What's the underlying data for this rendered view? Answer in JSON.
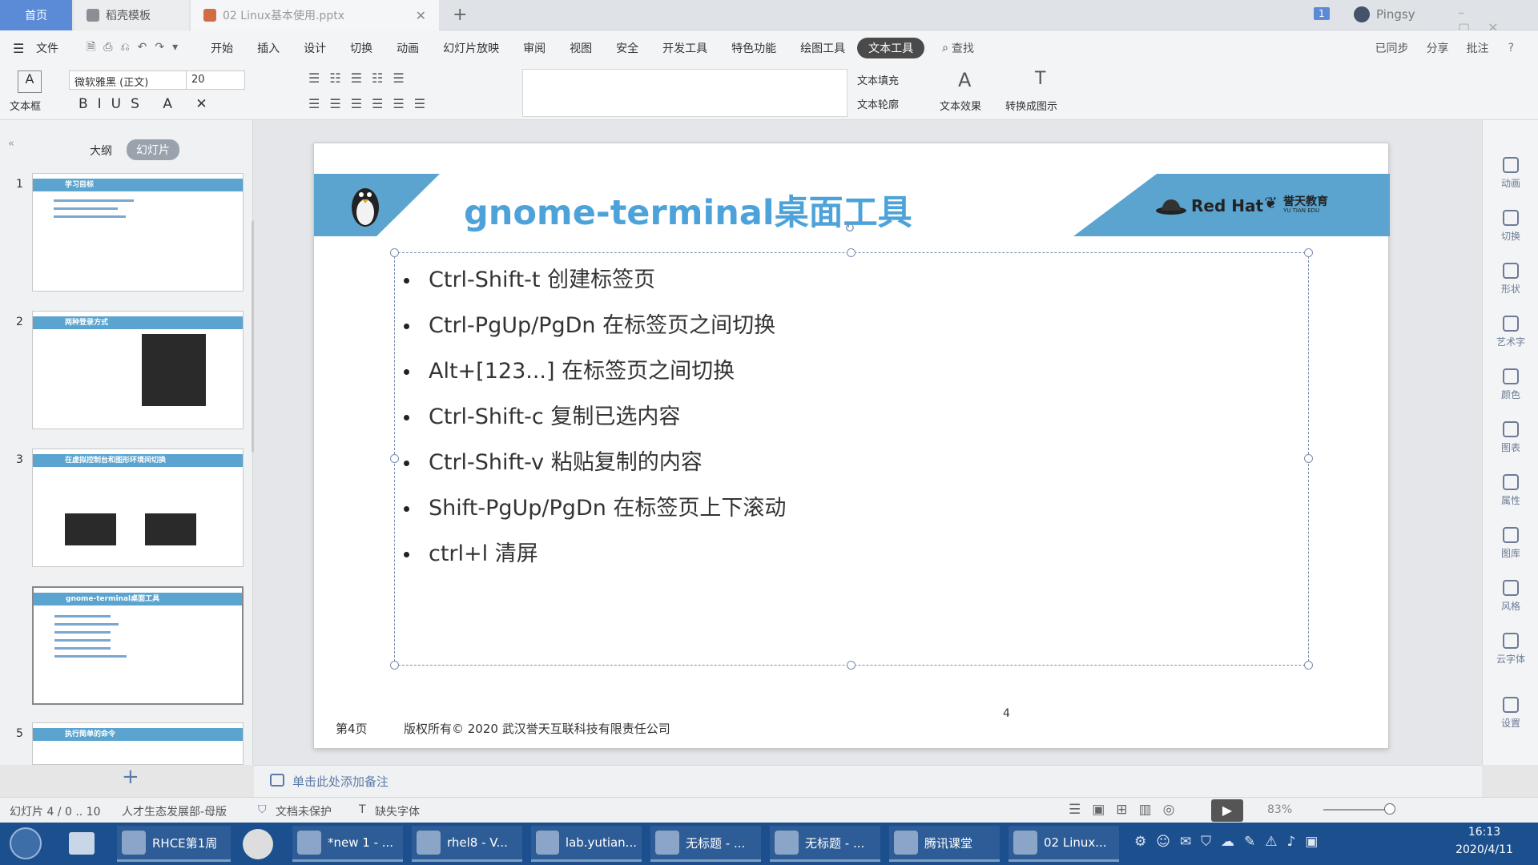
{
  "tabs": {
    "home": "首页",
    "template": "稻壳模板",
    "file": "02 Linux基本使用.pptx",
    "user_badge": "1",
    "user": "Pingsy"
  },
  "menu": {
    "items": [
      "文件",
      "开始",
      "插入",
      "设计",
      "切换",
      "动画",
      "幻灯片放映",
      "审阅",
      "视图",
      "安全",
      "开发工具",
      "特色功能",
      "绘图工具",
      "文本工具"
    ],
    "search": "查找",
    "sync": "已同步",
    "share": "分享",
    "comment": "批注"
  },
  "ribbon": {
    "textbox": "文本框",
    "font_name": "微软雅黑 (正文)",
    "font_size": "20",
    "text_fill": "文本填充",
    "text_outline": "文本轮廓",
    "text_effect": "文本效果",
    "convert_smartart": "转换成图示"
  },
  "panel": {
    "outline_tab": "大纲",
    "slides_tab": "幻灯片"
  },
  "thumbs": [
    {
      "num": "1",
      "title": "学习目标"
    },
    {
      "num": "2",
      "title": "两种登录方式"
    },
    {
      "num": "3",
      "title": "在虚拟控制台和图形环境间切换"
    },
    {
      "num": "",
      "title": "gnome-terminal桌面工具"
    },
    {
      "num": "5",
      "title": "执行简单的命令"
    }
  ],
  "slide": {
    "title": "gnome-terminal桌面工具",
    "brand_redhat": "Red Hat",
    "brand_yutian": "誉天教育",
    "brand_yutian_en": "YU TIAN EDU",
    "bullets": [
      "Ctrl-Shift-t  创建标签页",
      "Ctrl-PgUp/PgDn 在标签页之间切换",
      "Alt+[123...] 在标签页之间切换",
      "Ctrl-Shift-c 复制已选内容",
      "Ctrl-Shift-v  粘贴复制的内容",
      "Shift-PgUp/PgDn 在标签页上下滚动",
      "ctrl+l 清屏"
    ],
    "footer_page": "第4页",
    "footer_copyright": "版权所有© 2020 武汉誉天互联科技有限责任公司",
    "page_number": "4"
  },
  "notes_placeholder": "单击此处添加备注",
  "right_tools": [
    "动画",
    "切换",
    "形状",
    "艺术字",
    "颜色",
    "图表",
    "属性",
    "图库",
    "风格",
    "云字体",
    "设置"
  ],
  "status": {
    "slide_info": "幻灯片 4 / 0 .. 10",
    "theme": "人才生态发展部-母版",
    "protect": "文档未保护",
    "missing_font": "缺失字体",
    "zoom": "83%"
  },
  "taskbar": {
    "items": [
      "RHCE第1周",
      "*new 1 - ...",
      "rhel8 - V...",
      "lab.yutian...",
      "无标题 - ...",
      "无标题 - ...",
      "腾讯课堂",
      "02 Linux..."
    ],
    "time": "16:13",
    "date": "2020/4/11"
  },
  "colors": {
    "accent": "#5ba4cf",
    "title_blue": "#4da3d9",
    "taskbar": "#1c4f8e"
  }
}
